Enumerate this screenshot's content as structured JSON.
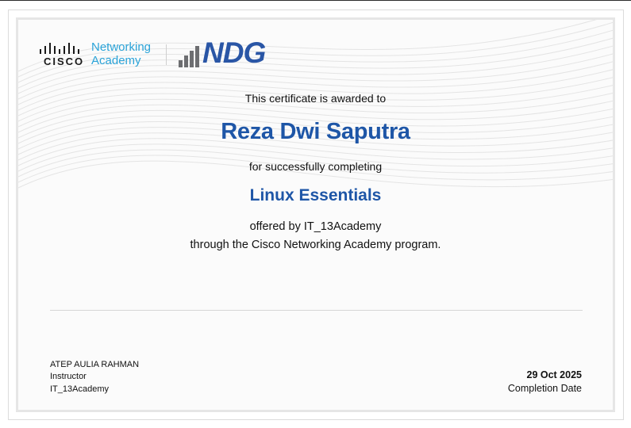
{
  "branding": {
    "cisco": "CISCO",
    "networking_academy_line1": "Networking",
    "networking_academy_line2": "Academy",
    "ndg": "NDG"
  },
  "certificate": {
    "awarded_text": "This certificate is awarded to",
    "recipient": "Reza Dwi Saputra",
    "completing_text": "for successfully completing",
    "course": "Linux Essentials",
    "offered_text": "offered by IT_13Academy",
    "through_text": "through the Cisco Networking Academy program."
  },
  "instructor": {
    "name": "ATEP AULIA RAHMAN",
    "role": "Instructor",
    "academy": "IT_13Academy"
  },
  "completion": {
    "date": "29 Oct 2025",
    "label": "Completion Date"
  },
  "colors": {
    "accent_blue": "#1e56a7",
    "cisco_cyan": "#2aa3d8",
    "ndg_blue": "#2a56a6"
  }
}
